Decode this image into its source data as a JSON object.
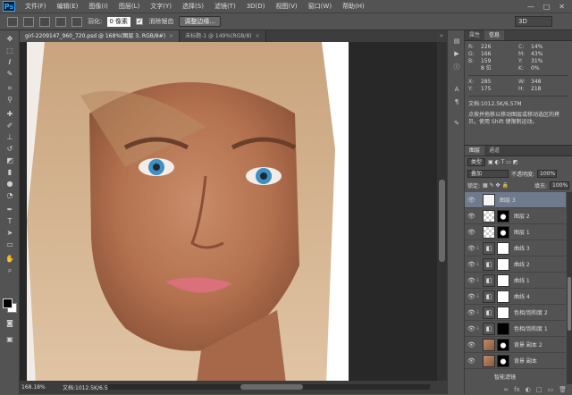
{
  "menubar": {
    "logo": "Ps",
    "items": [
      "文件(F)",
      "编辑(E)",
      "图像(I)",
      "图层(L)",
      "文字(Y)",
      "选择(S)",
      "滤镜(T)",
      "3D(D)",
      "视图(V)",
      "窗口(W)",
      "帮助(H)"
    ],
    "controls": [
      "—",
      "□",
      "✕"
    ]
  },
  "options": {
    "feather_label": "羽化:",
    "feather_value": "0 像素",
    "antialias_label": "消除锯齿",
    "refine_button": "调整边缘...",
    "workspace": "3D"
  },
  "tabs": [
    {
      "label": "girl-2209147_960_720.psd @ 168%(图层 3, RGB/8#)",
      "close": "×"
    },
    {
      "label": "未标题-1 @ 149%(RGB/8)",
      "close": "×"
    }
  ],
  "status": {
    "zoom": "168.18%",
    "doc": "文档:1012.5K/6.57M"
  },
  "info_panel": {
    "tabs": [
      "属性",
      "信息"
    ],
    "rows": [
      [
        {
          "k": "R:",
          "v": "226"
        },
        {
          "k": "C:",
          "v": "14%"
        }
      ],
      [
        {
          "k": "G:",
          "v": "166"
        },
        {
          "k": "M:",
          "v": "43%"
        }
      ],
      [
        {
          "k": "B:",
          "v": "159"
        },
        {
          "k": "Y:",
          "v": "31%"
        }
      ],
      [
        {
          "k": "",
          "v": "8 位"
        },
        {
          "k": "K:",
          "v": "0%"
        }
      ],
      [
        {
          "k": "X:",
          "v": "285"
        },
        {
          "k": "W:",
          "v": "348"
        }
      ],
      [
        {
          "k": "Y:",
          "v": "175"
        },
        {
          "k": "H:",
          "v": "218"
        }
      ]
    ],
    "doc": "文档:1012.5K/6.57M",
    "hint": "点按并拖移以移动图层或移动选区的拷贝。使用 Shift 键限制运动。"
  },
  "layers_panel": {
    "tabs": [
      "图层",
      "通道"
    ],
    "kind": "类型",
    "blend_mode": "叠加",
    "opacity_label": "不透明度:",
    "opacity_value": "100%",
    "lock_label": "锁定:",
    "fill_label": "填充:",
    "fill_value": "100%",
    "layers": [
      {
        "name": "图层 3",
        "thumb": "white",
        "mask": "",
        "selected": true
      },
      {
        "name": "图层 2",
        "thumb": "check",
        "mask": "bw",
        "selected": false
      },
      {
        "name": "图层 1",
        "thumb": "check",
        "mask": "bw",
        "selected": false
      },
      {
        "name": "曲线 3",
        "thumb": "adj",
        "mask": "white",
        "selected": false
      },
      {
        "name": "曲线 2",
        "thumb": "adj",
        "mask": "white",
        "selected": false
      },
      {
        "name": "曲线 1",
        "thumb": "adj",
        "mask": "white",
        "selected": false
      },
      {
        "name": "曲线 4",
        "thumb": "adj",
        "mask": "white",
        "selected": false
      },
      {
        "name": "色相/饱和度 2",
        "thumb": "adj",
        "mask": "white",
        "selected": false
      },
      {
        "name": "色相/饱和度 1",
        "thumb": "adj",
        "mask": "black",
        "selected": false
      },
      {
        "name": "背景 副本 2",
        "thumb": "photo",
        "mask": "bw",
        "selected": false
      },
      {
        "name": "背景 副本",
        "thumb": "photo",
        "mask": "bw",
        "selected": false
      }
    ],
    "fx_label": "智能滤镜",
    "bottom_icons": [
      "∞",
      "fx",
      "◐",
      "□",
      "▭",
      "🗑"
    ]
  },
  "tool_icons": [
    "move-icon",
    "marquee-icon",
    "lasso-icon",
    "quick-select-icon",
    "crop-icon",
    "eyedropper-icon",
    "healing-icon",
    "brush-icon",
    "stamp-icon",
    "history-brush-icon",
    "eraser-icon",
    "gradient-icon",
    "blur-icon",
    "dodge-icon",
    "pen-icon",
    "type-icon",
    "path-select-icon",
    "shape-icon",
    "hand-icon",
    "zoom-icon"
  ]
}
